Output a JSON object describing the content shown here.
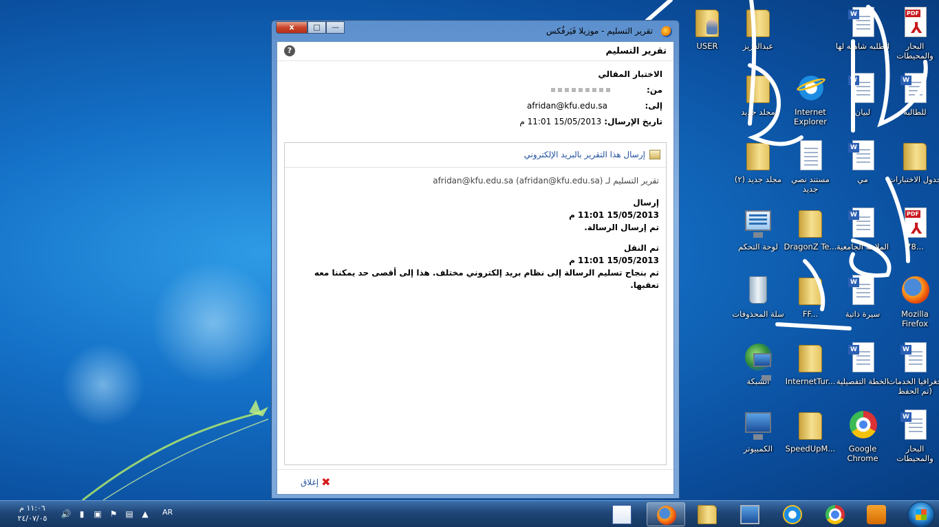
{
  "window": {
    "title": "تقرير التسليم - موزيلا فَيَرفُكس",
    "header_title": "تقرير التسليم",
    "help_label": "?",
    "subject": "الاختبار المقالي",
    "from_label": "من:",
    "to_label": "إلى:",
    "to_value": "afridan@kfu.edu.sa",
    "date_label": "تاريخ الإرسال:",
    "date_value": "15/05/2013 11:01 م",
    "send_report_link": "إرسال هذا التقرير بالبريد الإلكتروني",
    "report_to": "تقرير التسليم لـ afridan@kfu.edu.sa (afridan@kfu.edu.sa)",
    "events": [
      {
        "title": "إرسال",
        "time": "15/05/2013 11:01 م",
        "text": "تم إرسال الرسالة."
      },
      {
        "title": "تم النقل",
        "time": "15/05/2013 11:01 م",
        "text": "تم بنجاح تسليم الرسالة إلى نظام بريد إلكتروني مختلف. هذا إلى أقصى حد يمكننا معه تعقبها."
      }
    ],
    "close_label": "إغلاق",
    "caption_close": "x",
    "caption_max": "□",
    "caption_min": "—"
  },
  "desktop_icons": [
    {
      "label": "USER",
      "icon": "user-folder-icon"
    },
    {
      "label": "عبدالعزيز",
      "icon": "folder-icon"
    },
    {
      "label": "الطلبه شاهله لها",
      "icon": "word-doc-icon"
    },
    {
      "label": "البحار والمحيطات",
      "icon": "pdf-icon"
    },
    {
      "label": "مجلد جديد",
      "icon": "folder-icon"
    },
    {
      "label": "Internet Explorer (بدء...)",
      "icon": "internet-explorer-icon"
    },
    {
      "label": "لبيان",
      "icon": "word-doc-icon"
    },
    {
      "label": "للطالبة",
      "icon": "word-doc-icon"
    },
    {
      "label": "مجلد جديد (٢)",
      "icon": "folder-icon"
    },
    {
      "label": "مستند نصي جديد",
      "icon": "text-doc-icon"
    },
    {
      "label": "مي",
      "icon": "word-doc-icon"
    },
    {
      "label": "جدول الاختبارات",
      "icon": "folder-icon"
    },
    {
      "label": "لوحة التحكم",
      "icon": "control-panel-icon"
    },
    {
      "label": "DragonZ Te...",
      "icon": "folder-icon"
    },
    {
      "label": "الملاحة الجامعية",
      "icon": "word-doc-icon"
    },
    {
      "label": "78...",
      "icon": "pdf-icon"
    },
    {
      "label": "سلة المحذوفات",
      "icon": "recycle-bin-icon"
    },
    {
      "label": "FF...",
      "icon": "folder-icon"
    },
    {
      "label": "سيرة ذاتية",
      "icon": "word-doc-icon"
    },
    {
      "label": "Mozilla Firefox",
      "icon": "firefox-icon"
    },
    {
      "label": "الشبكة",
      "icon": "network-icon"
    },
    {
      "label": "InternetTur...",
      "icon": "folder-icon"
    },
    {
      "label": "الخطة التفصيلية",
      "icon": "word-doc-icon"
    },
    {
      "label": "جغرافيا الخدمات (تم الحفظ تلقا...",
      "icon": "word-doc-icon"
    },
    {
      "label": "الكمبيوتر",
      "icon": "computer-icon"
    },
    {
      "label": "SpeedUpM...",
      "icon": "folder-icon"
    },
    {
      "label": "Google Chrome",
      "icon": "chrome-icon"
    },
    {
      "label": "البحار والمحيطات",
      "icon": "word-doc-icon"
    }
  ],
  "taskbar": {
    "time": "١١:٠٦ م",
    "date": "٢٤/٠٧/٠٥",
    "language": "AR",
    "apps": [
      "word-icon",
      "firefox-icon",
      "explorer-icon",
      "computer-icon",
      "internet-explorer-icon",
      "chrome-icon",
      "media-player-icon"
    ]
  }
}
